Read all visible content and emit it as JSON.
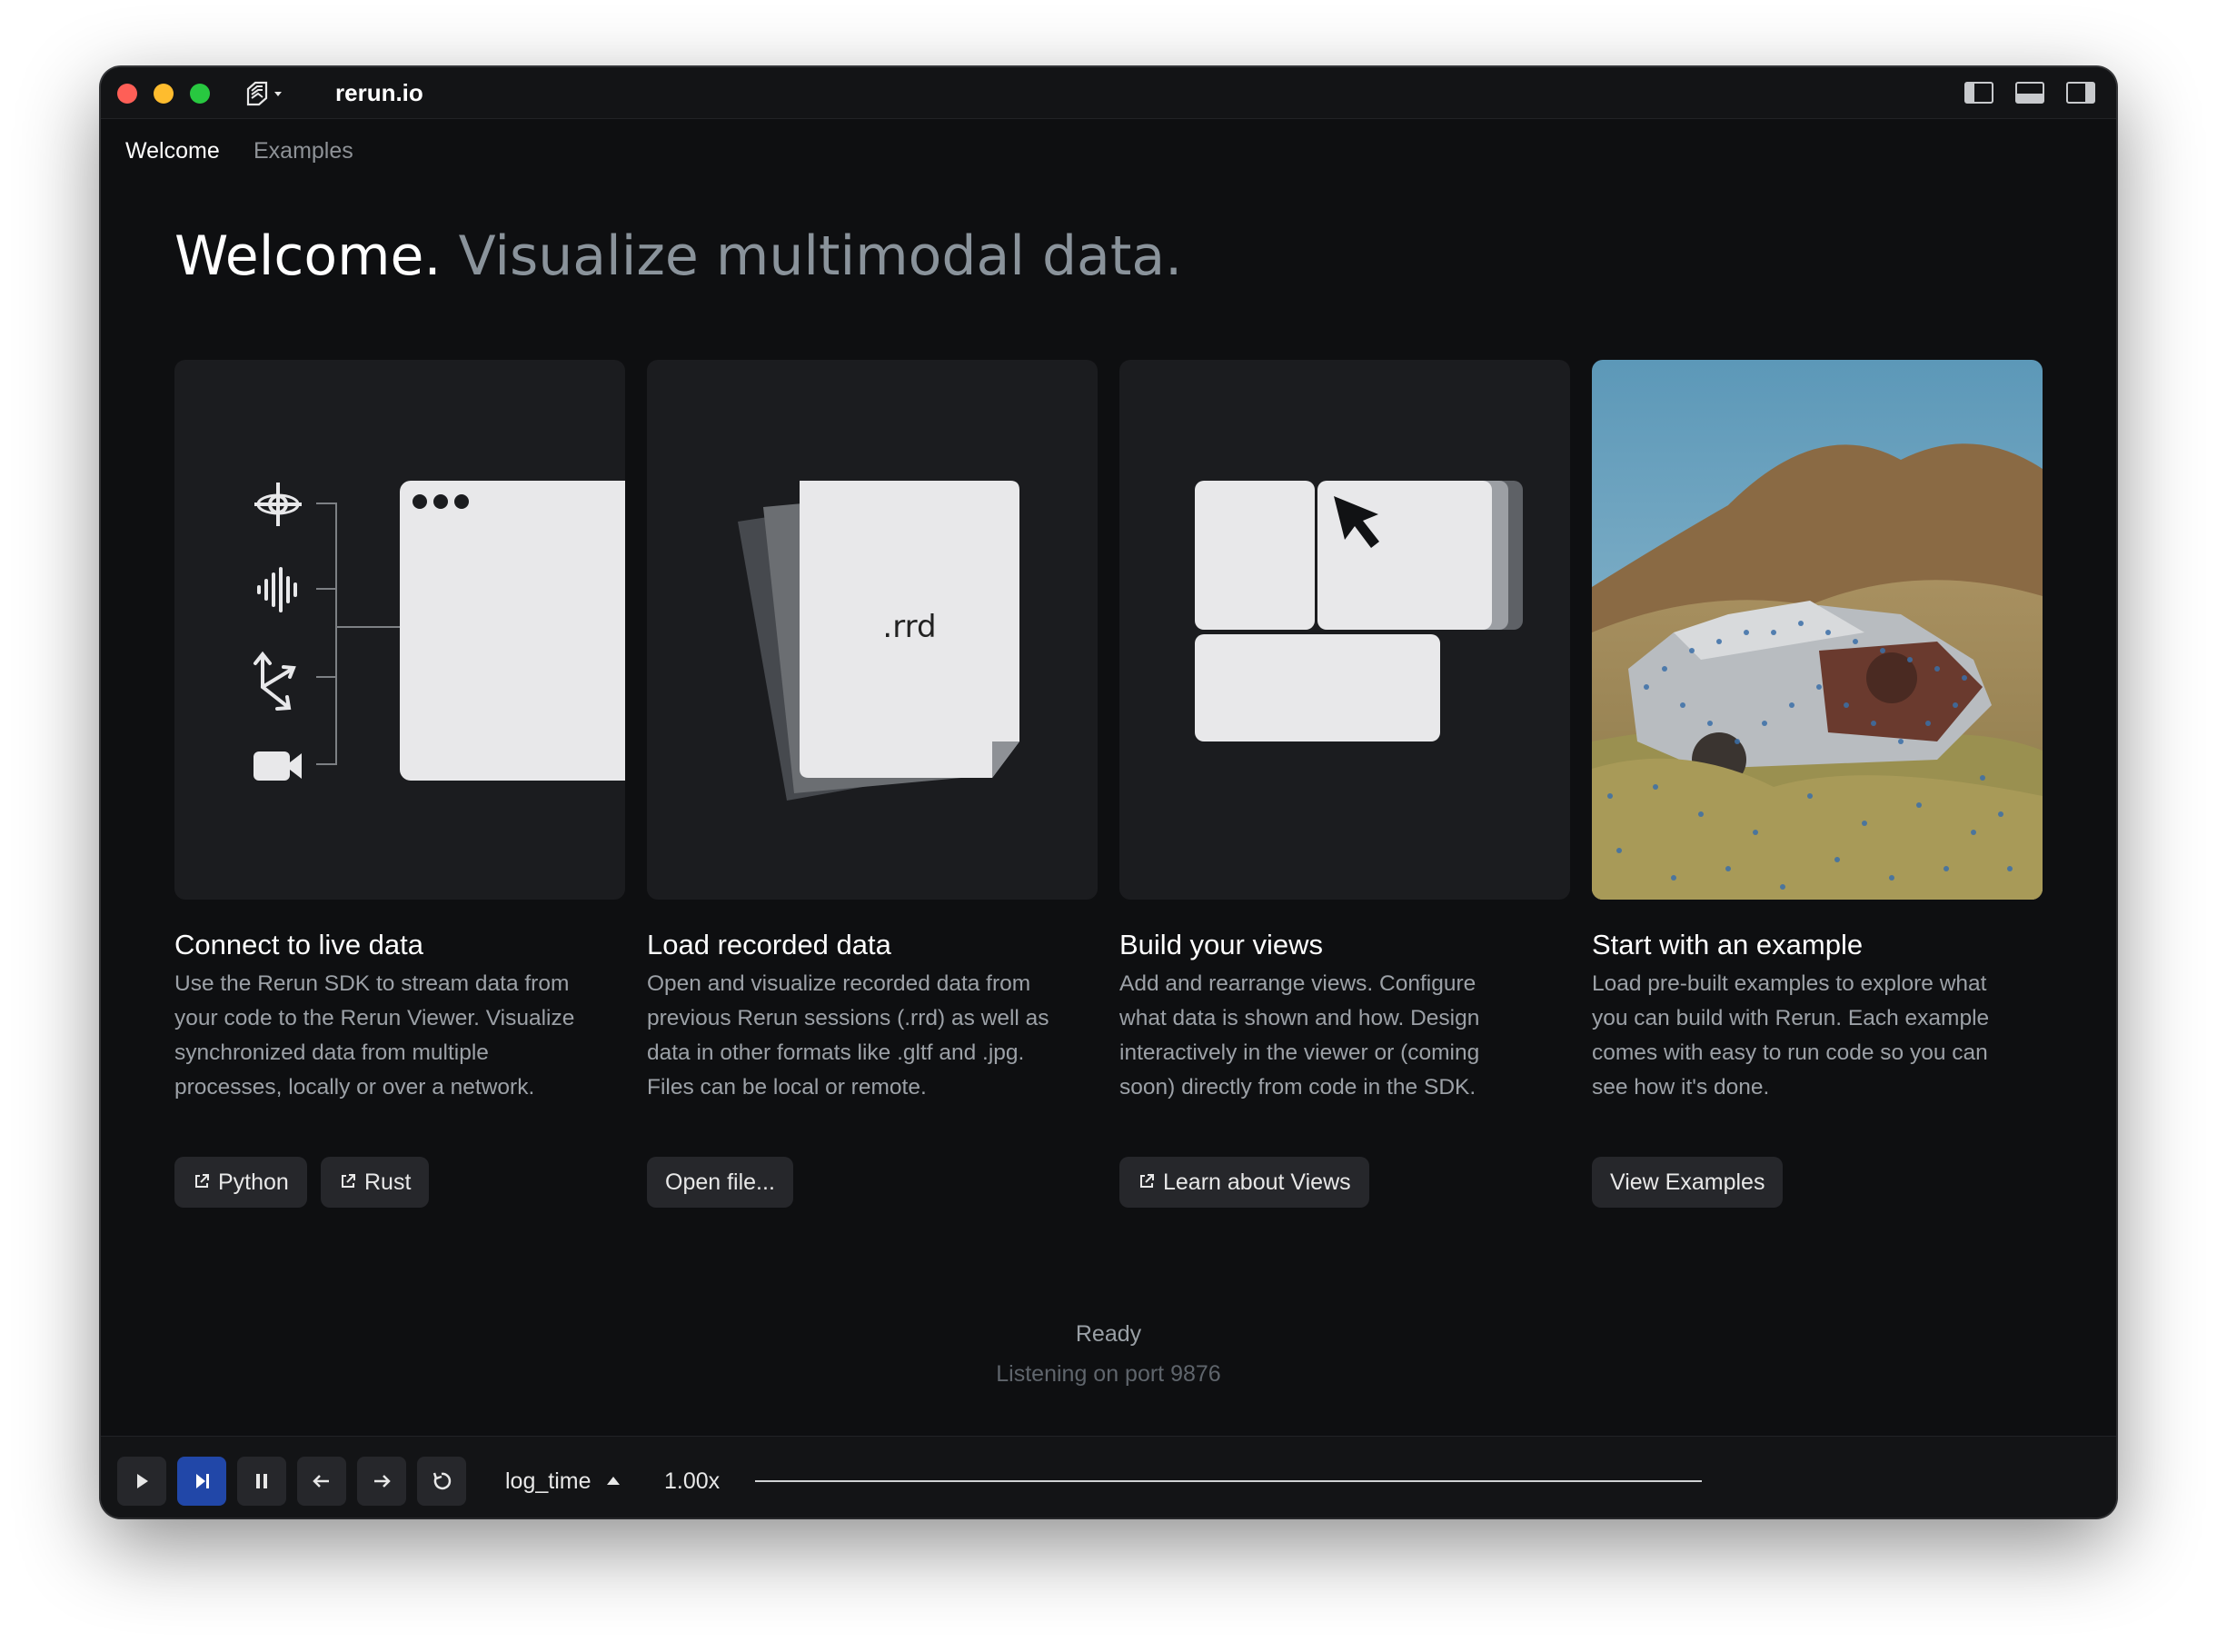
{
  "window": {
    "title": "rerun.io",
    "tabs": [
      {
        "label": "Welcome",
        "active": true
      },
      {
        "label": "Examples",
        "active": false
      }
    ]
  },
  "hero": {
    "title_strong": "Welcome.",
    "title_muted": "Visualize multimodal data."
  },
  "cards": [
    {
      "title": "Connect to live data",
      "lines": [
        "Use the Rerun SDK to stream data from",
        "your code to the Rerun Viewer. Visualize",
        "synchronized data from multiple",
        "processes, locally or over a network."
      ],
      "buttons": [
        {
          "label": "Python",
          "icon": "external-link-icon"
        },
        {
          "label": "Rust",
          "icon": "external-link-icon"
        }
      ],
      "illustration_icons": [
        "transform-axes-icon",
        "audio-waveform-icon",
        "branch-arrows-icon",
        "video-camera-icon"
      ]
    },
    {
      "title": "Load recorded data",
      "lines": [
        "Open and visualize recorded data from",
        "previous Rerun sessions (.rrd) as well as",
        "data in other formats like .gltf and .jpg.",
        "Files can be local or remote."
      ],
      "buttons": [
        {
          "label": "Open file...",
          "icon": ""
        }
      ],
      "file_label": ".rrd"
    },
    {
      "title": "Build your views",
      "lines": [
        "Add and rearrange views. Configure",
        "what data is shown and how. Design",
        "interactively in the viewer or (coming",
        "soon) directly from code in the SDK."
      ],
      "buttons": [
        {
          "label": "Learn about Views",
          "icon": "external-link-icon"
        }
      ],
      "illustration_icons": [
        "cursor-arrow-icon"
      ]
    },
    {
      "title": "Start with an example",
      "lines": [
        "Load pre-built examples to explore what",
        "you can build with Rerun. Each example",
        "comes with easy to run code so you can",
        "see how it's done."
      ],
      "buttons": [
        {
          "label": "View Examples",
          "icon": ""
        }
      ]
    }
  ],
  "status": {
    "ready": "Ready",
    "listening": "Listening on port 9876"
  },
  "playback": {
    "controls": [
      "play-icon",
      "step-forward-icon",
      "pause-icon",
      "arrow-left-icon",
      "arrow-right-icon",
      "loop-icon"
    ],
    "active_control": "step-forward-icon",
    "timeline": "log_time",
    "speed": "1.00x"
  },
  "colors": {
    "background": "#0e0f11",
    "card": "#1b1c1f",
    "accent": "#2147a8",
    "muted_text": "#9ca1a7"
  }
}
